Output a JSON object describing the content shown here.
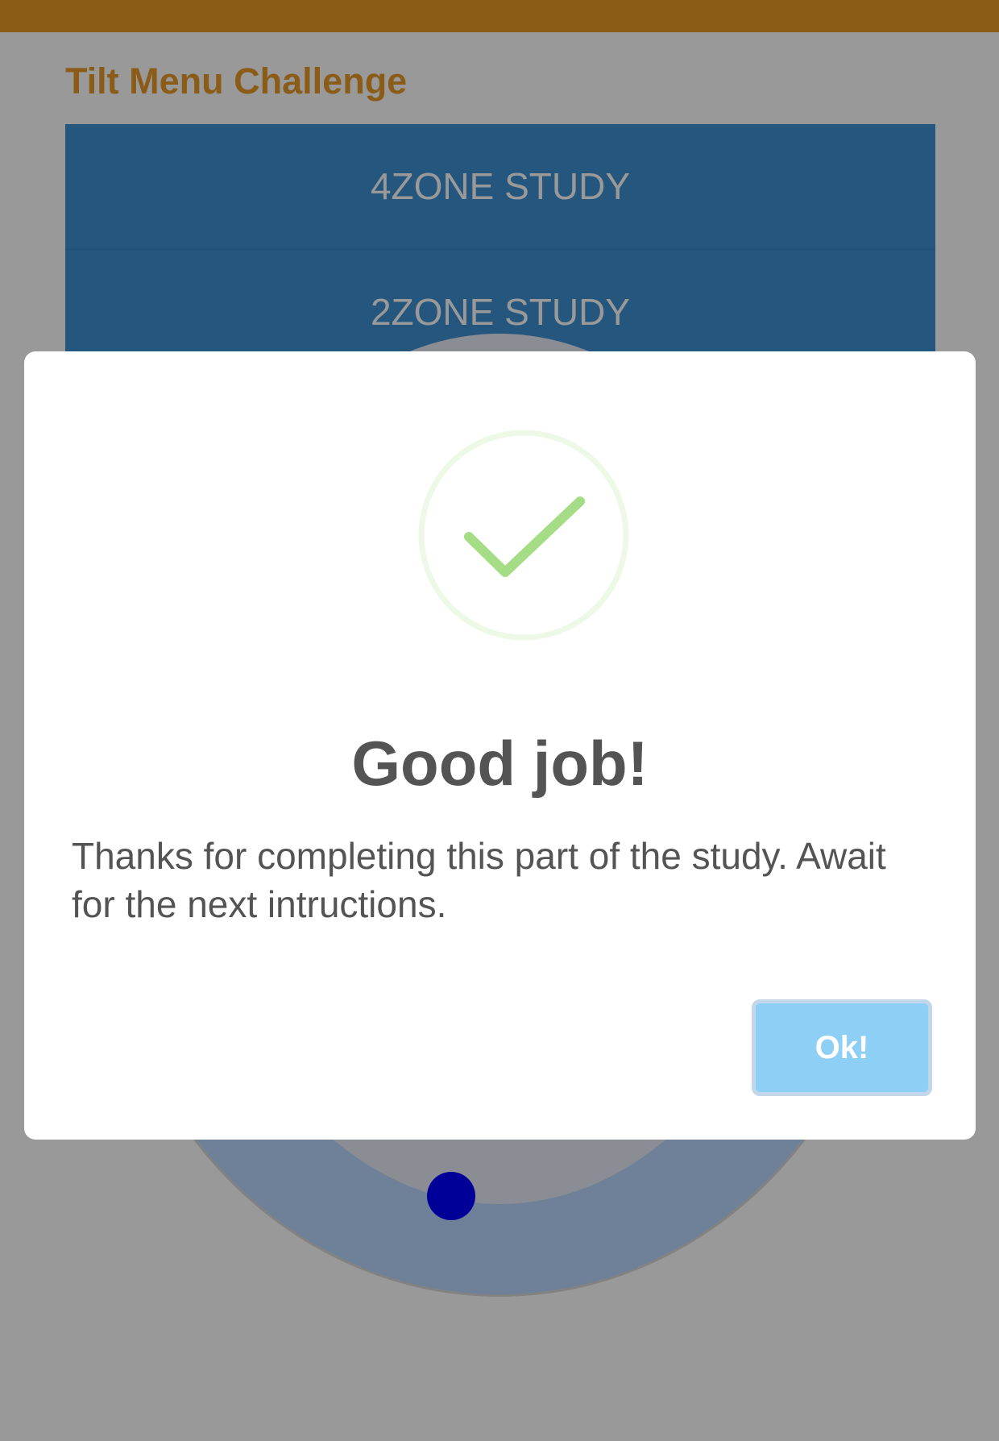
{
  "app": {
    "title": "Tilt Menu Challenge",
    "colors": {
      "topbar": "#e69a28",
      "title": "#e69a28",
      "menu_item": "#3f8fd1",
      "ring": "#b7d8ff",
      "ring_inner": "#e6ecf5",
      "cursor": "#0000ff"
    }
  },
  "menu": {
    "items": [
      {
        "label": "4ZONE STUDY"
      },
      {
        "label": "2ZONE STUDY"
      }
    ]
  },
  "dialog": {
    "icon": "checkmark-success-icon",
    "title": "Good job!",
    "message": "Thanks for completing this part of the study. Await for the next intructions.",
    "confirm_label": "Ok!",
    "colors": {
      "check": "#a5dc86",
      "check_ring": "rgba(165,220,134,0.2)",
      "button": "#8ecff5",
      "text": "#545454"
    }
  }
}
